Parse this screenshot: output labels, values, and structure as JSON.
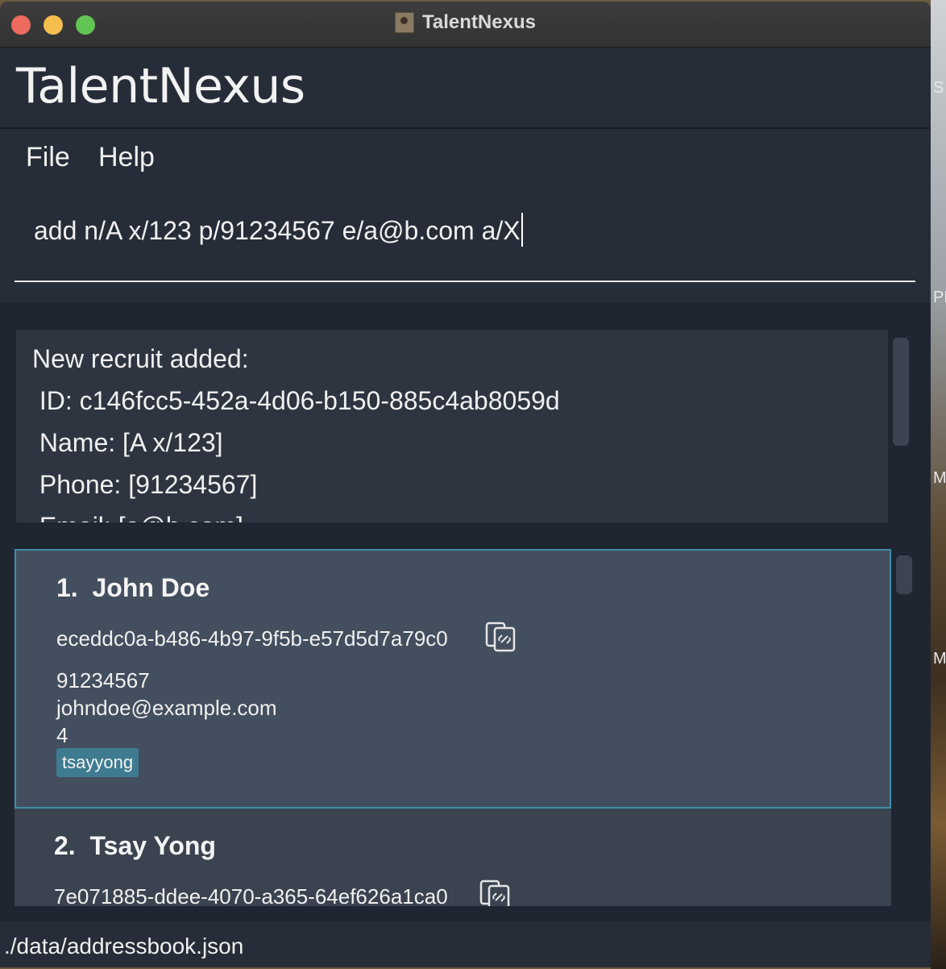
{
  "window": {
    "title": "TalentNexus"
  },
  "app": {
    "name": "TalentNexus"
  },
  "menu": {
    "file_label": "File",
    "help_label": "Help"
  },
  "command": {
    "value": "add n/A x/123 p/91234567 e/a@b.com a/X"
  },
  "result": {
    "lines": [
      "New recruit added:",
      " ID: c146fcc5-452a-4d06-b150-885c4ab8059d",
      " Name: [A x/123]",
      " Phone: [91234567]",
      " Email: [a@b.com]"
    ]
  },
  "recruits": [
    {
      "index": "1.",
      "name": "John Doe",
      "id": "eceddc0a-b486-4b97-9f5b-e57d5d7a79c0",
      "phone": "91234567",
      "email": "johndoe@example.com",
      "address": "4",
      "tags": [
        "tsayyong"
      ]
    },
    {
      "index": "2.",
      "name": "Tsay Yong",
      "id": "7e071885-ddee-4070-a365-64ef626a1ca0"
    }
  ],
  "status": {
    "file_path": "./data/addressbook.json"
  },
  "desktop": {
    "fragments": [
      "S",
      "PM",
      "M",
      "M"
    ]
  },
  "colors": {
    "selected_border": "#3f8ea8",
    "tag_bg": "#3e7b91",
    "background": "#202631"
  },
  "icons": {
    "copy": "copy-link-icon",
    "app": "contacts-app-icon"
  }
}
